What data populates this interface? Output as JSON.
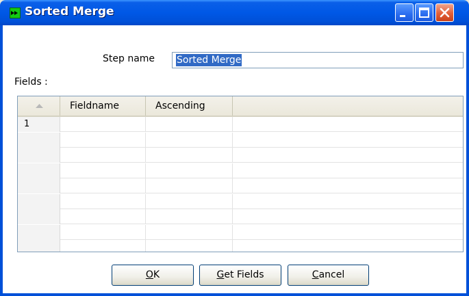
{
  "window": {
    "title": "Sorted Merge",
    "title_bar_buttons": [
      "minimize",
      "maximize",
      "close"
    ],
    "accent_color": "#0058e6"
  },
  "form": {
    "step_name_label": "Step name",
    "step_name_value": "Sorted Merge",
    "fields_label": "Fields :"
  },
  "grid": {
    "columns": [
      "",
      "Fieldname",
      "Ascending",
      ""
    ],
    "rows": [
      {
        "num": "1",
        "fieldname": "",
        "ascending": ""
      },
      {
        "num": "",
        "fieldname": "",
        "ascending": ""
      },
      {
        "num": "",
        "fieldname": "",
        "ascending": ""
      },
      {
        "num": "",
        "fieldname": "",
        "ascending": ""
      },
      {
        "num": "",
        "fieldname": "",
        "ascending": ""
      },
      {
        "num": "",
        "fieldname": "",
        "ascending": ""
      },
      {
        "num": "",
        "fieldname": "",
        "ascending": ""
      },
      {
        "num": "",
        "fieldname": "",
        "ascending": ""
      },
      {
        "num": "",
        "fieldname": "",
        "ascending": ""
      }
    ]
  },
  "buttons": {
    "ok": {
      "mnemonic": "O",
      "rest": "K"
    },
    "get_fields": {
      "mnemonic": "G",
      "rest": "et Fields"
    },
    "cancel": {
      "mnemonic": "C",
      "rest": "ancel"
    }
  }
}
